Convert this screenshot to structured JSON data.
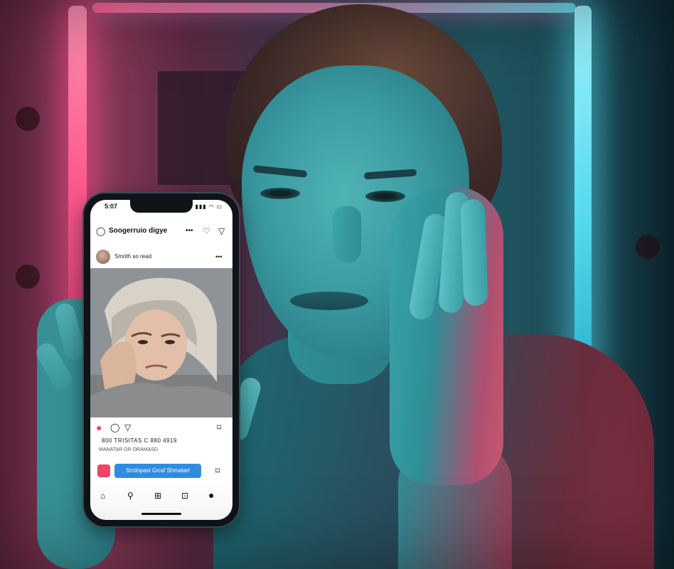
{
  "phone": {
    "status_time": "5:07",
    "app_title": "Soogerruio digye",
    "post_username": "Smrith so read",
    "like_count_text": "800 TRISITAS C 880 4919",
    "caption_text": "MANATAR OR ORAMASD",
    "cta_label": "Srrdnpast Grraf Shmatart"
  },
  "icons": {
    "status": [
      "signal-icon",
      "wifi-icon",
      "battery-icon"
    ],
    "topbar": [
      "camera-icon",
      "more-icon",
      "heart-icon",
      "send-icon"
    ],
    "post_actions": [
      "heart-icon",
      "comment-icon",
      "send-icon",
      "bookmark-icon"
    ],
    "navbar": [
      "home-icon",
      "search-icon",
      "reels-icon",
      "shop-icon",
      "profile-icon"
    ]
  },
  "colors": {
    "neon_pink": "#ff5a8f",
    "neon_cyan": "#55d9ee",
    "like_red": "#ee4466",
    "cta_blue": "#2f8de0"
  }
}
